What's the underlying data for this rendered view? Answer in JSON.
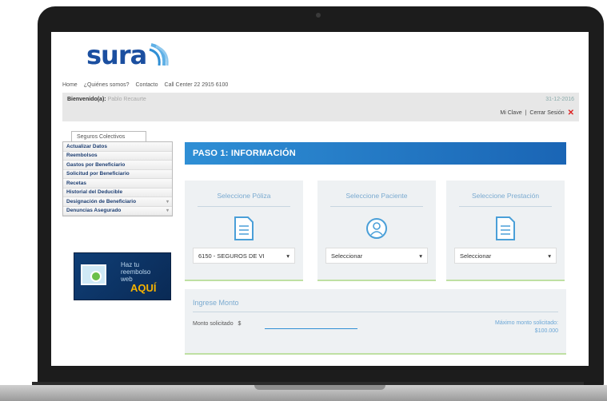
{
  "brand": {
    "logo_text": "sura"
  },
  "topnav": {
    "items": [
      "Home",
      "¿Quiénes somos?",
      "Contacto",
      "Call Center 22 2915 6100"
    ]
  },
  "userbar": {
    "welcome_label": "Bienvenido(a):",
    "user_name": "Pablo Recaurte",
    "date": "31-12-2016",
    "mi_clave": "Mi Clave",
    "separator": "|",
    "cerrar_sesion": "Cerrar Sesión"
  },
  "sidebar": {
    "tab": "Seguros Colectivos",
    "items": [
      {
        "label": "Actualizar Datos",
        "chevron": ""
      },
      {
        "label": "Reembolsos",
        "chevron": ""
      },
      {
        "label": "Gastos por Beneficiario",
        "chevron": ""
      },
      {
        "label": "Solicitud por Beneficiario",
        "chevron": ""
      },
      {
        "label": "Recetas",
        "chevron": ""
      },
      {
        "label": "Historial del Deducible",
        "chevron": ""
      },
      {
        "label": "Designación de Beneficiario",
        "chevron": "▾"
      },
      {
        "label": "Denuncias Asegurado",
        "chevron": "▾"
      }
    ],
    "promo": {
      "line1": "Haz tu",
      "line2": "reembolso",
      "line3": "web",
      "aqui": "AQUÍ"
    }
  },
  "main": {
    "step_title": "PASO 1: INFORMACIÓN",
    "cards": [
      {
        "title": "Seleccione Póliza",
        "icon": "document-icon",
        "selected": "6150 - SEGUROS DE VI"
      },
      {
        "title": "Seleccione Paciente",
        "icon": "user-icon",
        "selected": "Seleccionar"
      },
      {
        "title": "Seleccione Prestación",
        "icon": "document-icon",
        "selected": "Seleccionar"
      }
    ],
    "monto": {
      "title": "Ingrese Monto",
      "label": "Monto solicitado",
      "currency": "$",
      "value": "",
      "max_line1": "Máximo monto solicitado:",
      "max_line2": "$100.000"
    }
  },
  "colors": {
    "brand_blue": "#1b4fa0",
    "banner_blue": "#2f8fd5",
    "accent_green": "#bfe0a3",
    "promo_yellow": "#f5b200"
  }
}
